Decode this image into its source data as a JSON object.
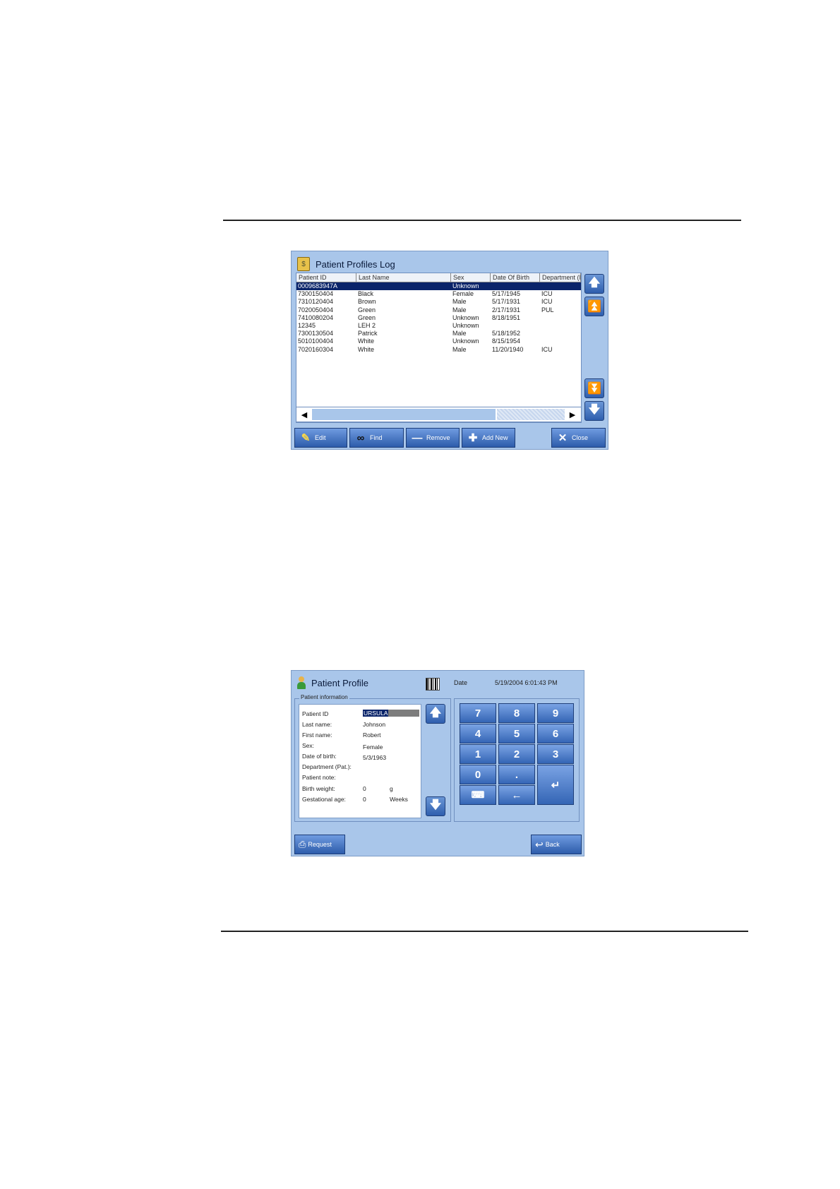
{
  "log": {
    "title": "Patient Profiles Log",
    "columns": [
      "Patient ID",
      "Last Name",
      "Sex",
      "Date Of Birth",
      "Department (I"
    ],
    "rows": [
      [
        "0009683947A",
        "",
        "Unknown",
        "",
        ""
      ],
      [
        "7300150404",
        "Black",
        "Female",
        "5/17/1945",
        "ICU"
      ],
      [
        "7310120404",
        "Brown",
        "Male",
        "5/17/1931",
        "ICU"
      ],
      [
        "7020050404",
        "Green",
        "Male",
        "2/17/1931",
        "PUL"
      ],
      [
        "7410080204",
        "Green",
        "Unknown",
        "8/18/1951",
        ""
      ],
      [
        "12345",
        "LEH 2",
        "Unknown",
        "",
        ""
      ],
      [
        "7300130504",
        "Patrick",
        "Male",
        "5/18/1952",
        ""
      ],
      [
        "5010100404",
        "White",
        "Unknown",
        "8/15/1954",
        ""
      ],
      [
        "7020160304",
        "White",
        "Male",
        "11/20/1940",
        "ICU"
      ]
    ],
    "toolbar": {
      "edit": "Edit",
      "find": "Find",
      "remove": "Remove",
      "add_new": "Add New",
      "close": "Close"
    }
  },
  "profile": {
    "title": "Patient Profile",
    "date_label": "Date",
    "date_value": "5/19/2004 6:01:43 PM",
    "group_title": "Patient information",
    "fields": {
      "patient_id": {
        "label": "Patient ID",
        "value": "URSULA"
      },
      "last_name": {
        "label": "Last name:",
        "value": "Johnson"
      },
      "first_name": {
        "label": "First name:",
        "value": "Robert"
      },
      "sex": {
        "label": "Sex:",
        "value": "Female"
      },
      "dob": {
        "label": "Date of birth:",
        "value": "5/3/1963"
      },
      "department": {
        "label": "Department (Pat.):",
        "value": ""
      },
      "note": {
        "label": "Patient note:",
        "value": ""
      },
      "birth_weight": {
        "label": "Birth weight:",
        "value": "0",
        "unit": "g"
      },
      "gestational_age": {
        "label": "Gestational age:",
        "value": "0",
        "unit": "Weeks"
      }
    },
    "keys": {
      "k7": "7",
      "k8": "8",
      "k9": "9",
      "k4": "4",
      "k5": "5",
      "k6": "6",
      "k1": "1",
      "k2": "2",
      "k3": "3",
      "k0": "0",
      "dot": "."
    },
    "request": "Request",
    "back": "Back"
  },
  "icons": {
    "up": "arrow-up-icon",
    "page_up": "double-arrow-up-icon",
    "page_down": "double-arrow-down-icon",
    "down": "arrow-down-icon",
    "left": "arrow-left-icon",
    "right": "arrow-right-icon"
  }
}
